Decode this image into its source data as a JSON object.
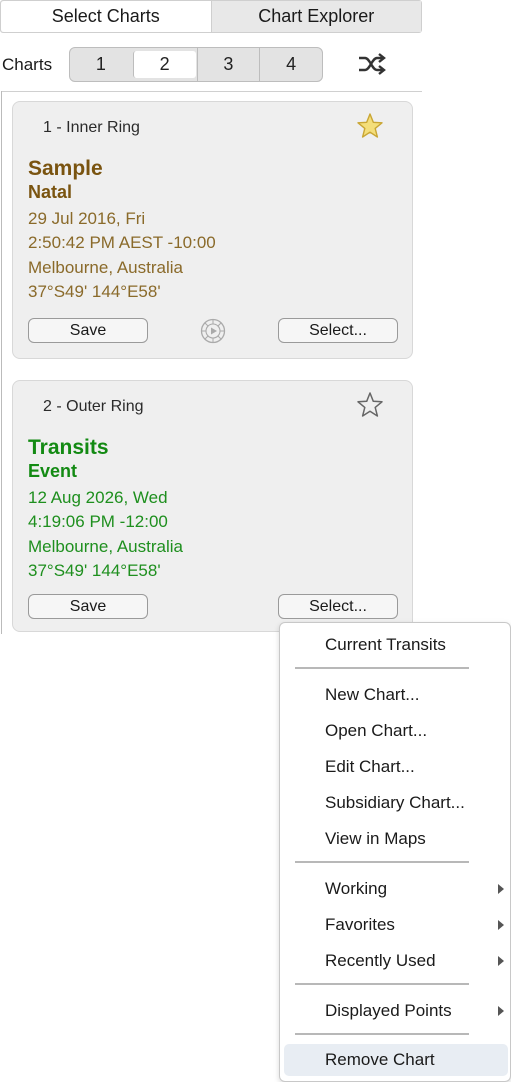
{
  "top_tabs": [
    "Select Charts",
    "Chart Explorer"
  ],
  "charts_label": "Charts",
  "chart_slots": [
    "1",
    "2",
    "3",
    "4"
  ],
  "selected_slot": "2",
  "cards": [
    {
      "ring": "1 - Inner Ring",
      "name": "Sample",
      "type": "Natal",
      "date": "29 Jul 2016, Fri",
      "time": "2:50:42 PM AEST -10:00",
      "place": "Melbourne, Australia",
      "coords": "37°S49' 144°E58'",
      "favorite": true,
      "save_label": "Save",
      "select_label": "Select...",
      "accent": "#7a5410"
    },
    {
      "ring": "2 - Outer Ring",
      "name": "Transits",
      "type": "Event",
      "date": "12 Aug 2026, Wed",
      "time": "4:19:06 PM -12:00",
      "place": "Melbourne, Australia",
      "coords": "37°S49' 144°E58'",
      "favorite": false,
      "save_label": "Save",
      "select_label": "Select...",
      "accent": "#138a13"
    }
  ],
  "menu": {
    "current_transits": "Current Transits",
    "new_chart": "New Chart...",
    "open_chart": "Open Chart...",
    "edit_chart": "Edit Chart...",
    "subsidiary_chart": "Subsidiary Chart...",
    "view_in_maps": "View in Maps",
    "working": "Working",
    "favorites": "Favorites",
    "recently_used": "Recently Used",
    "displayed_points": "Displayed Points",
    "remove_chart": "Remove Chart"
  }
}
